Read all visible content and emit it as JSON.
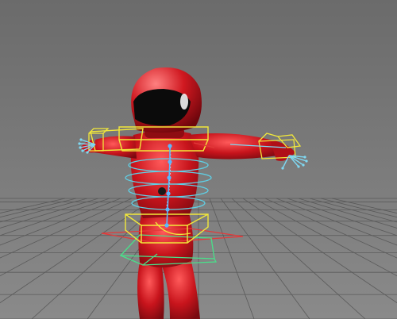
{
  "viewport": {
    "kind": "3d-viewport",
    "background_top": "#6b6b6b",
    "background_bottom": "#8a8a8a",
    "grid_color": "#5a5a5a"
  },
  "character": {
    "pose": "T-pose",
    "suit_color": "#c8141c",
    "suit_shadow": "#7a0a10",
    "visor_color": "#0b0b0b"
  },
  "rig": {
    "colors": {
      "chest_box": "#f2e83a",
      "hip_box": "#f2e83a",
      "spine_rings": "#5fd0e6",
      "ground_square": "#e23a3a",
      "hip_outer_box": "#49e08a",
      "hand_bones": "#7fd8f2",
      "spine_chain": "#5ab8ff"
    },
    "controls": [
      "ground-control-square",
      "hip-control-box",
      "hip-outer-box",
      "spine-ring-controls",
      "chest-control-box",
      "head-control",
      "left-hand-control-box",
      "right-hand-control-box",
      "spine-bone-chain",
      "left-finger-bones",
      "right-finger-bones"
    ]
  }
}
